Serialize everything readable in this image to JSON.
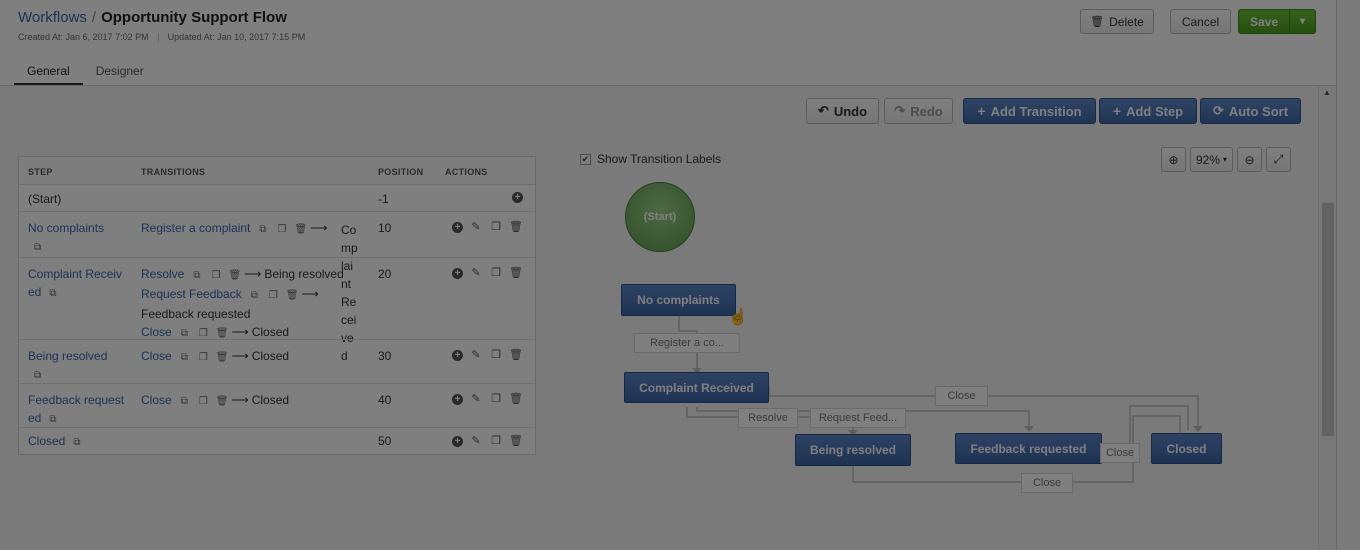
{
  "header": {
    "breadcrumb": "Workflows",
    "separator": "/",
    "workflow_name": "Opportunity Support Flow",
    "created_at": "Created At: Jan 6, 2017 7:02 PM",
    "updated_at": "Updated At: Jan 10, 2017 7:15 PM",
    "delete_label": "Delete",
    "cancel_label": "Cancel",
    "save_label": "Save",
    "save_dropdown": "▾"
  },
  "tabs": [
    "General",
    "Designer"
  ],
  "toolbar": {
    "undo": "Undo",
    "redo": "Redo",
    "add_transition": "Add Transition",
    "add_step": "Add Step",
    "auto_sort": "Auto Sort"
  },
  "table": {
    "headers": [
      "STEP",
      "TRANSITIONS",
      "POSITION",
      "ACTIONS"
    ],
    "rows": [
      {
        "step": "(Start)",
        "position": "-1"
      },
      {
        "step": "No complaints",
        "position": "10",
        "transitions": [
          {
            "name": "Register a complaint",
            "target": "Complaint Received"
          }
        ]
      },
      {
        "step": "Complaint Received",
        "position": "20",
        "transitions": [
          {
            "name": "Resolve",
            "target": "Being resolved"
          },
          {
            "name": "Request Feedback",
            "target": "Feedback requested"
          },
          {
            "name": "Close",
            "target": "Closed"
          }
        ]
      },
      {
        "step": "Being resolved",
        "position": "30",
        "transitions": [
          {
            "name": "Close",
            "target": "Closed"
          }
        ]
      },
      {
        "step": "Feedback requested",
        "position": "40",
        "transitions": [
          {
            "name": "Close",
            "target": "Closed"
          }
        ]
      },
      {
        "step": "Closed",
        "position": "50"
      }
    ]
  },
  "designer": {
    "show_labels": "Show Transition Labels",
    "zoom_level": "92%",
    "nodes": {
      "start": "(Start)",
      "no_complaints": "No complaints",
      "complaint_received": "Complaint Received",
      "being_resolved": "Being resolved",
      "feedback_requested": "Feedback requested",
      "closed": "Closed"
    },
    "labels": {
      "register": "Register a co...",
      "resolve": "Resolve",
      "request_feedback": "Request Feed...",
      "close_top": "Close",
      "close_mid": "Close",
      "close_bottom": "Close"
    }
  }
}
